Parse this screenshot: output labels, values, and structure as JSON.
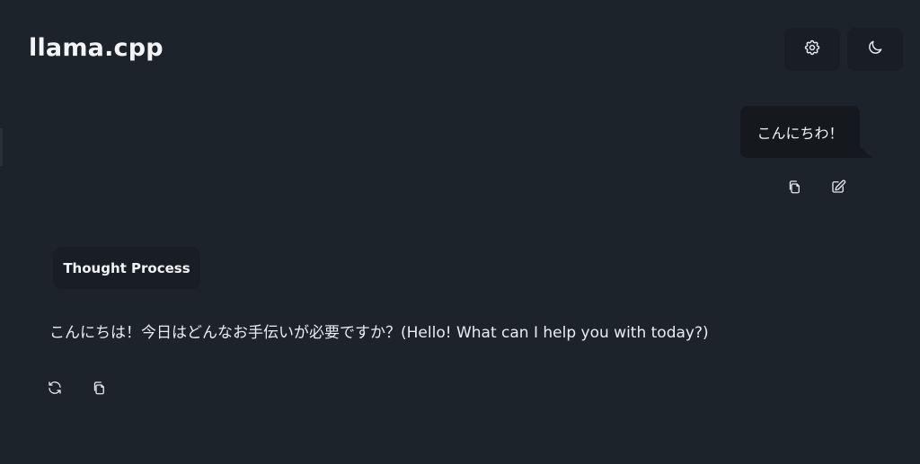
{
  "header": {
    "title": "llama.cpp",
    "settings_icon": "gear-icon",
    "theme_icon": "moon-icon"
  },
  "messages": {
    "user": {
      "text": "こんにちわ！",
      "actions": [
        "copy-icon",
        "edit-icon"
      ]
    },
    "assistant": {
      "thought_label": "Thought Process",
      "text": "こんにちは！今日はどんなお手伝いが必要ですか？(Hello! What can I help you with today?)",
      "actions": [
        "regenerate-icon",
        "copy-icon"
      ]
    }
  },
  "colors": {
    "background": "#1d232a",
    "surface": "#191e24",
    "bubble": "#15191e",
    "text": "#e6e9ee"
  }
}
